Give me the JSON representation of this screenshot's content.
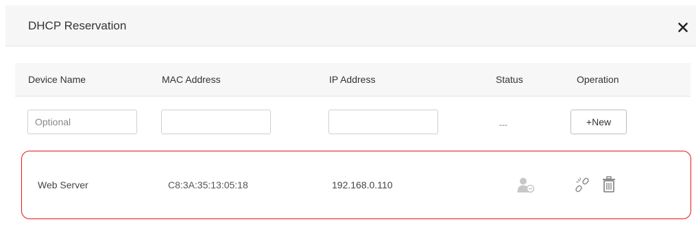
{
  "dialog": {
    "title": "DHCP Reservation",
    "close_icon": "close-icon"
  },
  "table": {
    "headers": {
      "device_name": "Device Name",
      "mac_address": "MAC Address",
      "ip_address": "IP Address",
      "status": "Status",
      "operation": "Operation"
    },
    "new_entry": {
      "device_name_value": "",
      "device_name_placeholder": "Optional",
      "mac_value": "",
      "ip_value": "",
      "status_text": "---",
      "new_button_label": "+New"
    },
    "rows": [
      {
        "device_name": "Web Server",
        "mac": "C8:3A:35:13:05:18",
        "ip": "192.168.0.110",
        "status_icon": "user-offline-icon",
        "operations": [
          "unbind-icon",
          "delete-icon"
        ]
      }
    ]
  },
  "colors": {
    "highlight_border": "#e5101b",
    "header_bg": "#f6f6f6",
    "icon_gray": "#8a8a8a",
    "status_icon_gray": "#c8c8c8"
  }
}
